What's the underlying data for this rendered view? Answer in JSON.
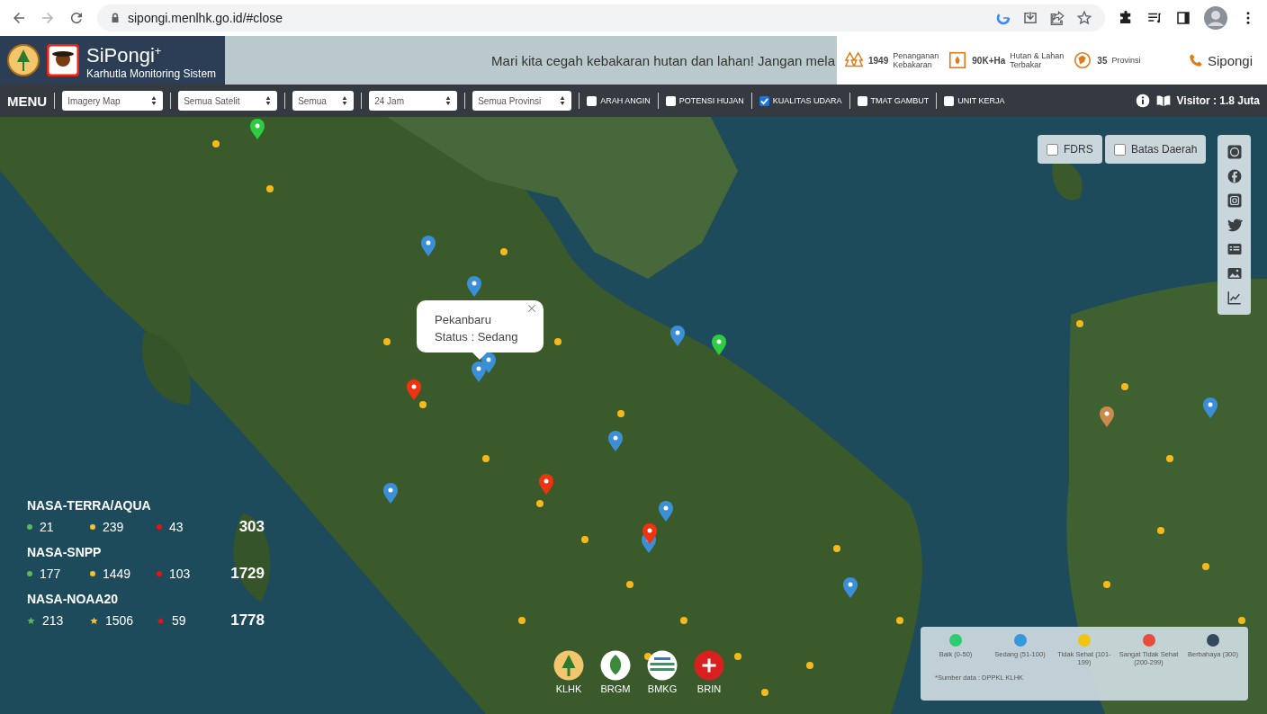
{
  "browser": {
    "url": "sipongi.menlhk.go.id/#close"
  },
  "header": {
    "title": "SiPongi$^{+}$",
    "subtitle": "Karhutla Monitoring Sistem",
    "marquee": "Mari kita cegah kebakaran hutan dan lahan! Jangan mela",
    "stats": [
      {
        "value": "1949",
        "label": [
          "Penanganan",
          "Kebakaran"
        ]
      },
      {
        "value": "90K+Ha",
        "label": [
          "Hutan & Lahan",
          "Terbakar"
        ]
      },
      {
        "value": "35",
        "label": [
          "Provinsi"
        ]
      }
    ],
    "contact": "Sipongi"
  },
  "menu": {
    "label": "MENU",
    "selects": [
      "Imagery Map",
      "Semua Satelit",
      "Semua",
      "24 Jam",
      "Semua Provinsi"
    ],
    "layers": [
      {
        "label": "ARAH ANGIN",
        "checked": false
      },
      {
        "label": "POTENSI HUJAN",
        "checked": false
      },
      {
        "label": "KUALITAS UDARA",
        "checked": true
      },
      {
        "label": "TMAT GAMBUT",
        "checked": false
      },
      {
        "label": "UNIT KERJA",
        "checked": false
      }
    ],
    "visitor": "Visitor : 1.8 Juta"
  },
  "map": {
    "toggles": [
      {
        "label": "FDRS",
        "checked": false
      },
      {
        "label": "Batas Daerah",
        "checked": false
      }
    ],
    "popup": {
      "lines": [
        "Pekanbaru",
        "Status : Sedang"
      ]
    },
    "satellites": [
      {
        "name": "NASA-TERRA/AQUA",
        "kind": "dot",
        "counts": [
          {
            "value": "21",
            "color": "#5cb85c"
          },
          {
            "value": "239",
            "color": "#f6c030"
          },
          {
            "value": "43",
            "color": "#ee1111"
          }
        ],
        "total": "303"
      },
      {
        "name": "NASA-SNPP",
        "kind": "dot",
        "counts": [
          {
            "value": "177",
            "color": "#5cb85c"
          },
          {
            "value": "1449",
            "color": "#f6c030"
          },
          {
            "value": "103",
            "color": "#ee1111"
          }
        ],
        "total": "1729"
      },
      {
        "name": "NASA-NOAA20",
        "kind": "star",
        "counts": [
          {
            "value": "213",
            "color": "#5cb85c"
          },
          {
            "value": "1506",
            "color": "#f6c030"
          },
          {
            "value": "59",
            "color": "#ee1111"
          }
        ],
        "total": "1778"
      }
    ],
    "legend": {
      "items": [
        {
          "label": "Baik (0-50)",
          "color": "#2ecc71"
        },
        {
          "label": "Sedang (51-100)",
          "color": "#3498db"
        },
        {
          "label": "Tidak Sehat (101-199)",
          "color": "#f1c40f"
        },
        {
          "label": "Sangat Tidak Sehat (200-299)",
          "color": "#e74c3c"
        },
        {
          "label": "Berbahaya (300)",
          "color": "#34495e"
        }
      ],
      "source": "*Sumber data : DPPKL KLHK"
    },
    "agencies": [
      "KLHK",
      "BRGM",
      "BMKG",
      "BRIN"
    ]
  }
}
